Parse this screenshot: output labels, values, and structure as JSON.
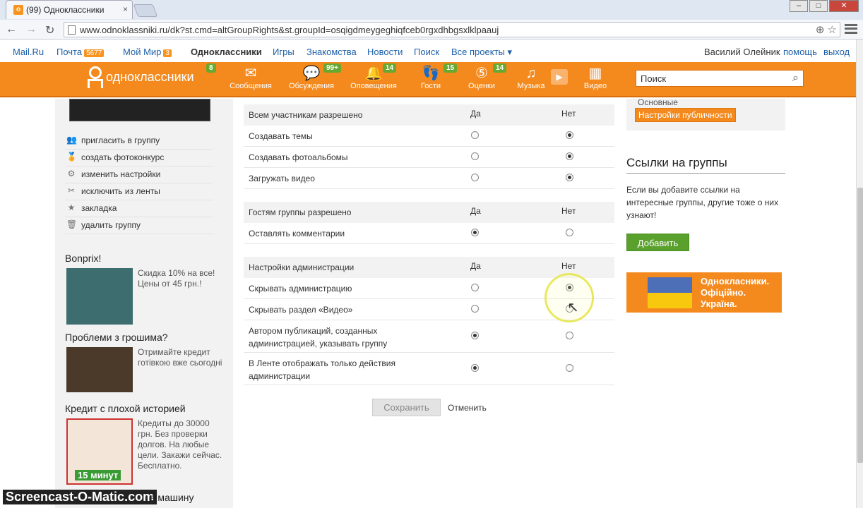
{
  "browser": {
    "tab_title": "(99) Одноклассники",
    "tab_close": "×",
    "url": "www.odnoklassniki.ru/dk?st.cmd=altGroupRights&st.groupId=osqigdmeygeghiqfceb0rgxdhbgsxlklpaauj",
    "win_min": "–",
    "win_max": "□",
    "win_close": "✕"
  },
  "topbar": {
    "mailru": "Mail.Ru",
    "pochta": "Почта",
    "pochta_count": "5677",
    "moymir": "Мой Мир",
    "moymir_count": "3",
    "ok": "Одноклассники",
    "igry": "Игры",
    "znakomstva": "Знакомства",
    "novosti": "Новости",
    "poisk": "Поиск",
    "vse": "Все проекты ▾",
    "user": "Василий Олейник",
    "help": "помощь",
    "exit": "выход"
  },
  "header": {
    "logo": "одноклассники",
    "logo_badge": "8",
    "items": [
      {
        "label": "Сообщения",
        "icon": "envelope-icon",
        "badge": ""
      },
      {
        "label": "Обсуждения",
        "icon": "chat-icon",
        "badge": "99+"
      },
      {
        "label": "Оповещения",
        "icon": "bell-icon",
        "badge": "14"
      },
      {
        "label": "Гости",
        "icon": "footprints-icon",
        "badge": "15"
      },
      {
        "label": "Оценки",
        "icon": "star-5-icon",
        "badge": "14"
      },
      {
        "label": "Музыка",
        "icon": "note-icon",
        "badge": ""
      },
      {
        "label": "Видео",
        "icon": "video-icon",
        "badge": ""
      }
    ],
    "search_placeholder": "Поиск"
  },
  "left_menu": [
    "пригласить в группу",
    "создать фотоконкурс",
    "изменить настройки",
    "исключить из ленты",
    "закладка",
    "удалить группу"
  ],
  "ads": [
    {
      "title": "Bonprix!",
      "text": "Скидка 10% на все! Цены от 45 грн.!"
    },
    {
      "title": "Проблеми з грошима?",
      "text": "Отримайте кредит готівкою вже сьогодні"
    },
    {
      "title": "Кредит с плохой историей",
      "text": "Кредиты до 30000 грн. Без проверки долгов. На любые цели. Закажи сейчас. Бесплатно.",
      "img_label": "15 минут"
    }
  ],
  "ad_partial": "в машину",
  "permissions": {
    "yes": "Да",
    "no": "Нет",
    "sections": [
      {
        "header": "Всем участникам разрешено",
        "rows": [
          {
            "label": "Создавать темы",
            "value": "no"
          },
          {
            "label": "Создавать фотоальбомы",
            "value": "no"
          },
          {
            "label": "Загружать видео",
            "value": "no"
          }
        ]
      },
      {
        "header": "Гостям группы разрешено",
        "rows": [
          {
            "label": "Оставлять комментарии",
            "value": "yes"
          }
        ]
      },
      {
        "header": "Настройки администрации",
        "rows": [
          {
            "label": "Скрывать администрацию",
            "value": "no"
          },
          {
            "label": "Скрывать раздел «Видео»",
            "value": "none"
          },
          {
            "label": "Автором публикаций, созданных администрацией, указывать группу",
            "value": "yes"
          },
          {
            "label": "В Ленте отображать только действия администрации",
            "value": "yes"
          }
        ]
      }
    ]
  },
  "actions": {
    "save": "Сохранить",
    "cancel": "Отменить"
  },
  "right": {
    "osnovnye": "Основные",
    "publicity": "Настройки публичности",
    "links_title": "Ссылки на группы",
    "links_text": "Если вы добавите ссылки на интересные группы, другие тоже о них узнают!",
    "add": "Добавить",
    "ua_text": "Однокласники. Офіційно. Україна."
  },
  "watermark": "Screencast-O-Matic.com"
}
